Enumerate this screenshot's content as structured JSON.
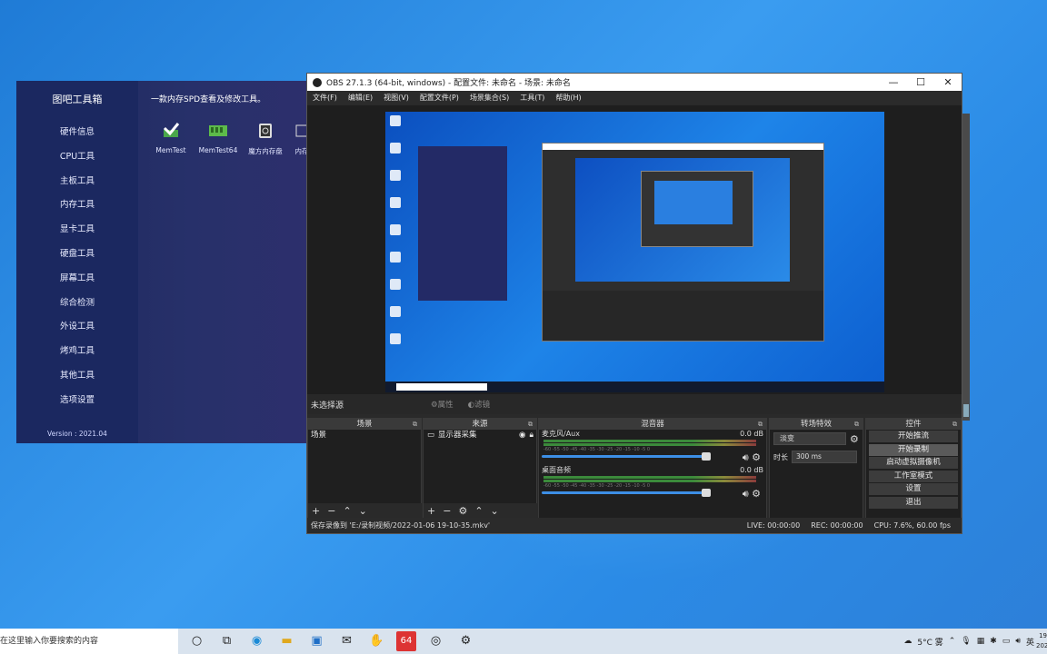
{
  "toolbox": {
    "title": "图吧工具箱",
    "description": "一款内存SPD查看及修改工具。",
    "menu": [
      "硬件信息",
      "CPU工具",
      "主板工具",
      "内存工具",
      "显卡工具",
      "硬盘工具",
      "屏幕工具",
      "综合检测",
      "外设工具",
      "烤鸡工具",
      "其他工具",
      "选项设置"
    ],
    "tools": [
      "MemTest",
      "MemTest64",
      "魔方内存盘",
      "内存"
    ],
    "version": "Version : 2021.04"
  },
  "obs": {
    "title": "OBS 27.1.3 (64-bit, windows) - 配置文件: 未命名 - 场景: 未命名",
    "menu": [
      "文件(F)",
      "编辑(E)",
      "视图(V)",
      "配置文件(P)",
      "场景集合(S)",
      "工具(T)",
      "帮助(H)"
    ],
    "source_bar": {
      "label": "未选择源",
      "properties": "属性",
      "filters": "滤镜"
    },
    "docks": {
      "scenes": {
        "title": "场景",
        "items": [
          "场景"
        ]
      },
      "sources": {
        "title": "来源",
        "items": [
          "显示器采集"
        ]
      },
      "mixer": {
        "title": "混音器",
        "channels": [
          {
            "name": "麦克风/Aux",
            "db": "0.0 dB",
            "level": 0.96
          },
          {
            "name": "桌面音频",
            "db": "0.0 dB",
            "level": 0.96
          }
        ],
        "ticks": [
          "-60",
          "-55",
          "-50",
          "-45",
          "-40",
          "-35",
          "-30",
          "-25",
          "-20",
          "-15",
          "-10",
          "-5",
          "0"
        ]
      },
      "transitions": {
        "title": "转场特效",
        "selected": "淡变",
        "duration_label": "时长",
        "duration": "300 ms"
      },
      "controls": {
        "title": "控件",
        "buttons": [
          "开始推流",
          "开始录制",
          "启动虚拟摄像机",
          "工作室模式",
          "设置",
          "退出"
        ]
      }
    },
    "status": {
      "message": "保存录像到 'E:/录制视频/2022-01-06 19-10-35.mkv'",
      "live": "LIVE: 00:00:00",
      "rec": "REC: 00:00:00",
      "cpu": "CPU: 7.6%, 60.00 fps"
    }
  },
  "taskbar": {
    "search_placeholder": "在这里输入你要搜索的内容",
    "app_badge": "64",
    "weather": "5°C 雾",
    "ime": "英",
    "clock_time": "19",
    "clock_date": "202"
  }
}
